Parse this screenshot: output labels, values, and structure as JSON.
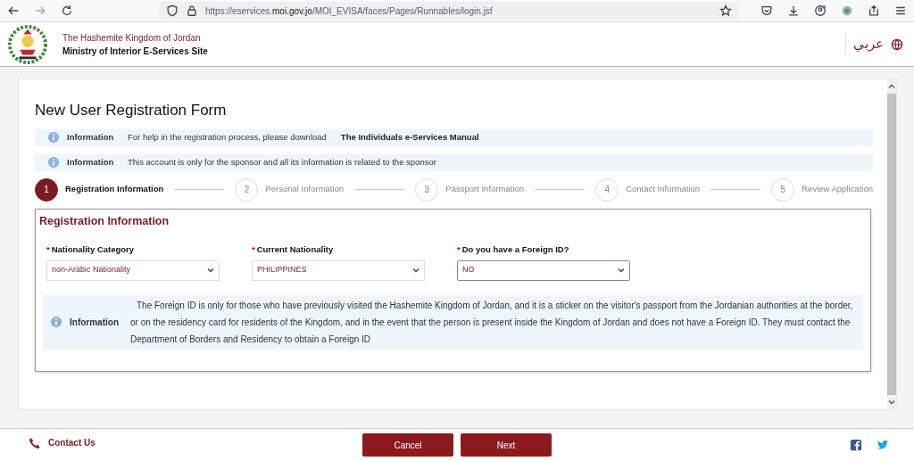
{
  "browser": {
    "url": "https://eservices.**moi.gov.jo**/MOI_EVISA/faces/Pages/Runnables/login.jsf"
  },
  "header": {
    "kingdom": "The Hashemite Kingdom of Jordan",
    "site": "Ministry of Interior E-Services Site",
    "language": "عربي"
  },
  "form": {
    "title": "New User Registration Form",
    "notices": [
      {
        "label": "Information",
        "text": "For help in the registration process, please download",
        "link": "The Individuals e-Services Manual"
      },
      {
        "label": "Information",
        "text": "This account is only for the sponsor and all its information is related to the sponsor"
      }
    ],
    "steps": [
      {
        "number": "1",
        "label": "Registration Information",
        "selected": true
      },
      {
        "number": "2",
        "label": "Personal Information",
        "selected": false
      },
      {
        "number": "3",
        "label": "Passport Information",
        "selected": false
      },
      {
        "number": "4",
        "label": "Contact Information",
        "selected": false
      },
      {
        "number": "5",
        "label": "Review Application",
        "selected": false
      }
    ],
    "section": {
      "title": "Registration Information",
      "fields": [
        {
          "label": "Nationality Category",
          "required_mark": "*",
          "value": "non-Arabic Nationality",
          "focused": false
        },
        {
          "label": "Current Nationality",
          "required_mark": "*",
          "value": "PHILIPPINES",
          "focused": false
        },
        {
          "label": "Do you have a Foreign ID?",
          "required_mark": "*",
          "value": "NO",
          "focused": true
        }
      ],
      "info": {
        "label": "Information",
        "text": "The Foreign ID is only for those who have previously visited the Hashemite Kingdom of Jordan, and it is a sticker on the visitor's passport from the Jordanian authorities at the border, or on the residency card for residents of the Kingdom, and in the event that the person is present inside the Kingdom of Jordan and does not have a Foreign ID. They must contact the Department of Borders and Residency to obtain a Foreign ID"
      }
    }
  },
  "footer": {
    "contact": "Contact Us",
    "buttons": [
      "Cancel",
      "Next"
    ]
  }
}
